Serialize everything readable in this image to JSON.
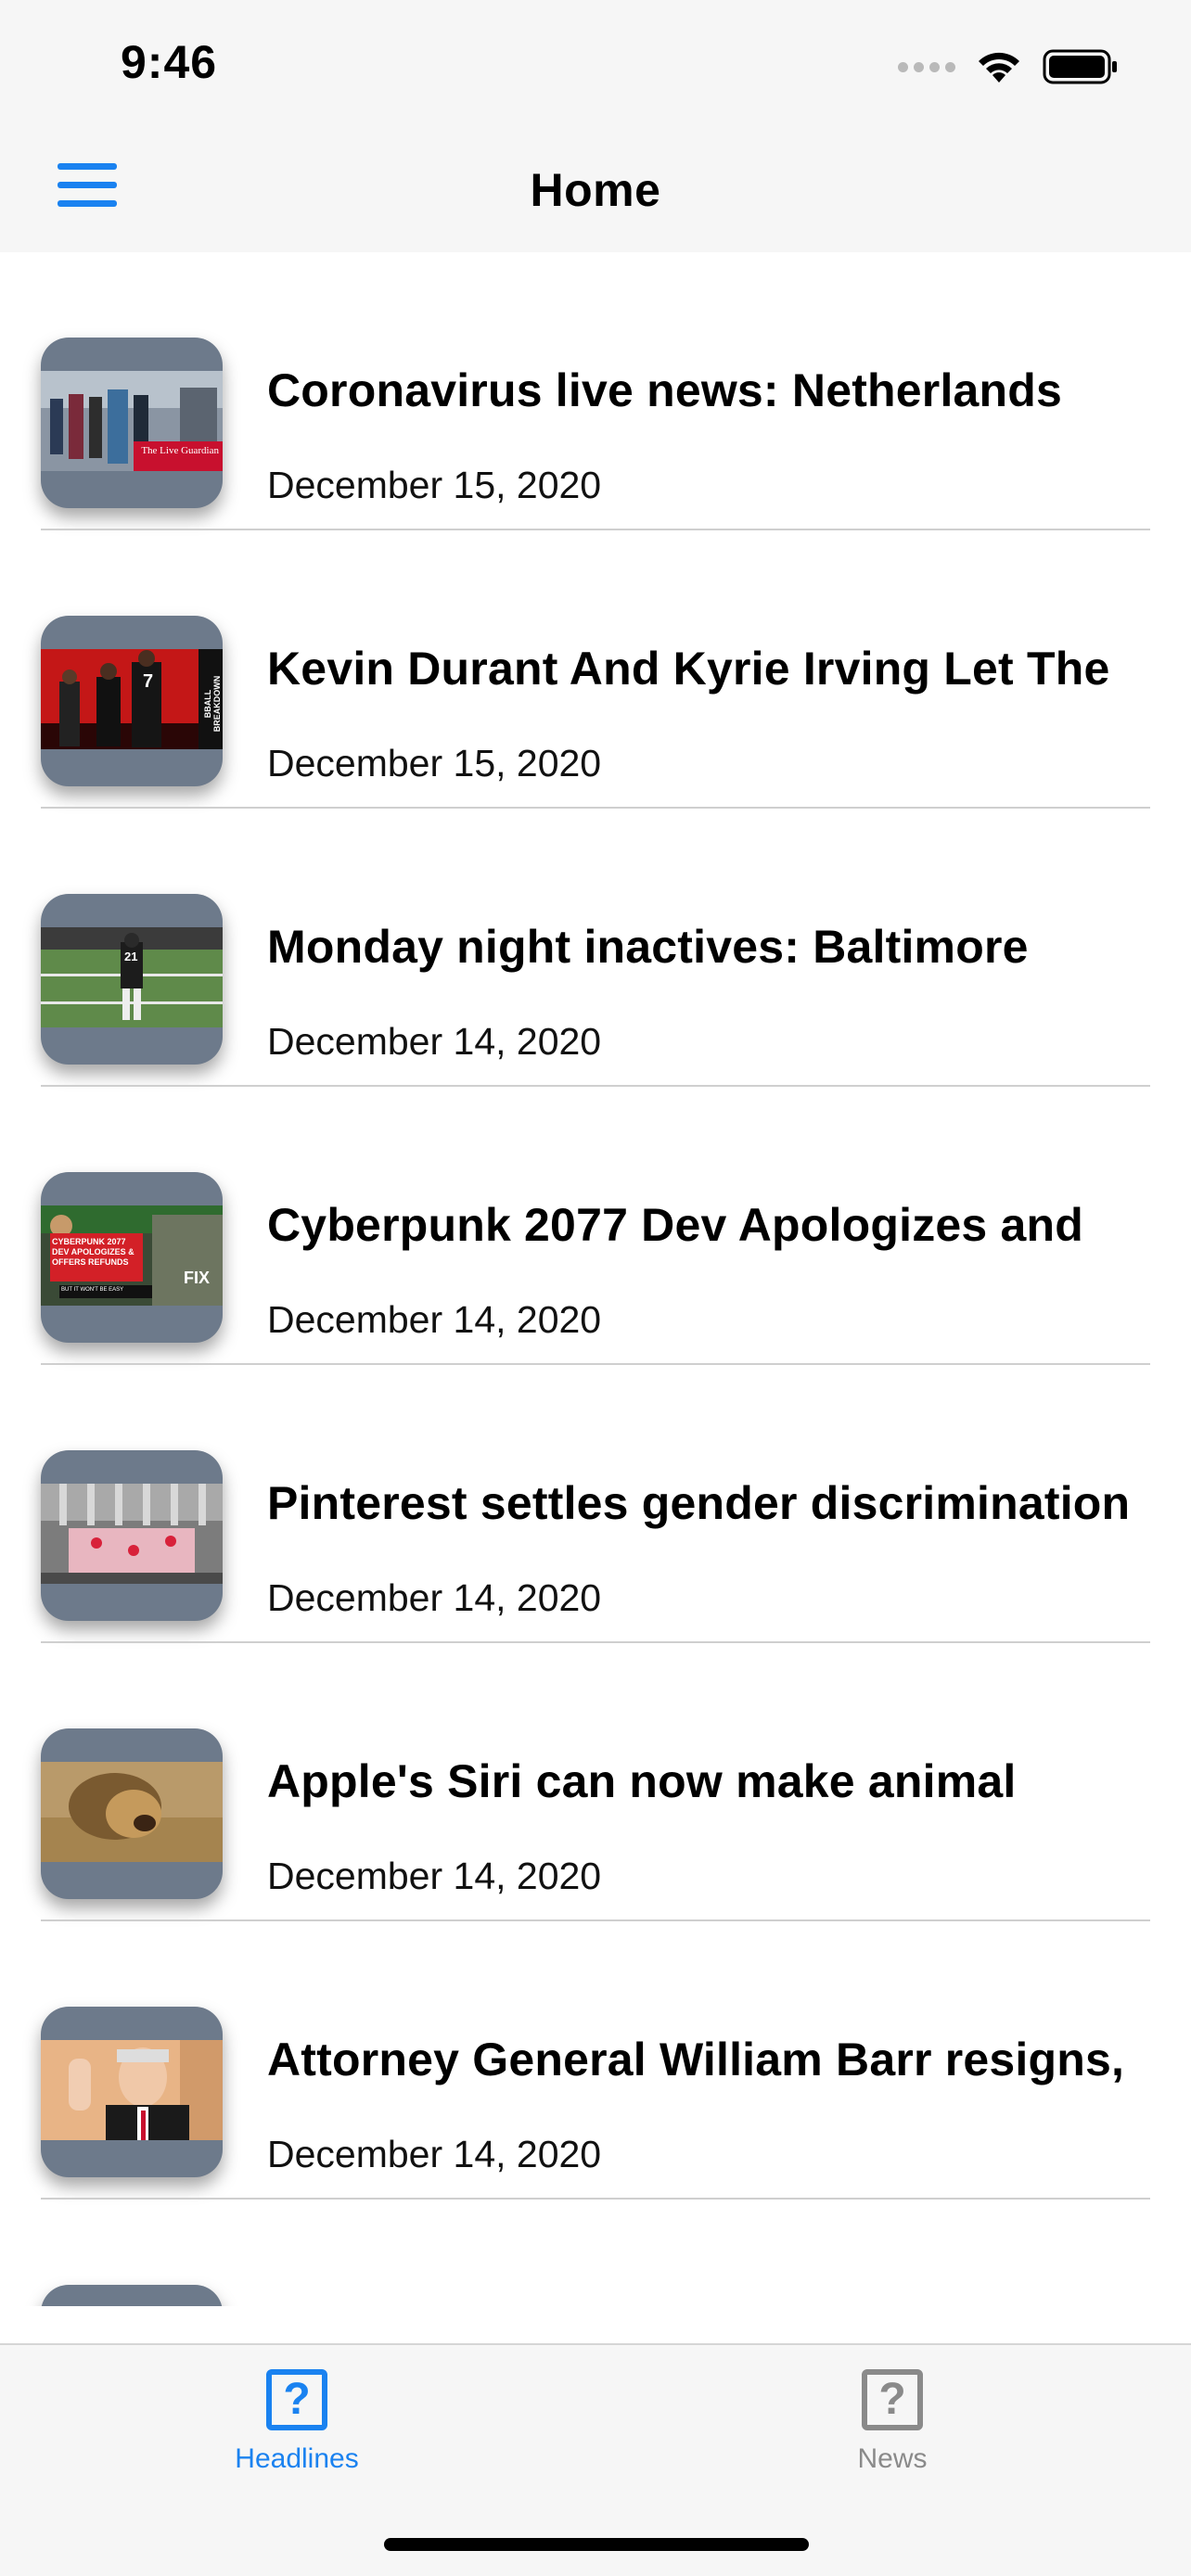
{
  "status_bar": {
    "time": "9:46"
  },
  "nav": {
    "title": "Home",
    "menu_icon": "hamburger-menu-icon"
  },
  "articles": [
    {
      "headline": "Coronavirus live news: Netherlands",
      "date": "December 15, 2020",
      "thumbnail": "crowd-street-photo"
    },
    {
      "headline": "Kevin Durant And Kyrie Irving Let The",
      "date": "December 15, 2020",
      "thumbnail": "basketball-players-photo"
    },
    {
      "headline": "Monday night inactives: Baltimore",
      "date": "December 14, 2020",
      "thumbnail": "football-player-photo"
    },
    {
      "headline": "Cyberpunk 2077 Dev Apologizes and",
      "date": "December 14, 2020",
      "thumbnail": "video-thumbnail"
    },
    {
      "headline": "Pinterest settles gender discrimination",
      "date": "December 14, 2020",
      "thumbnail": "stock-exchange-photo"
    },
    {
      "headline": "Apple's Siri can now make animal",
      "date": "December 14, 2020",
      "thumbnail": "lion-photo"
    },
    {
      "headline": "Attorney General William Barr resigns,",
      "date": "December 14, 2020",
      "thumbnail": "portrait-photo"
    }
  ],
  "thumbnail_text": {
    "guardian": "The Live Guardian",
    "cyberpunk": "CYBERPUNK 2077 DEV APOLOGIZES & OFFERS REFUNDS",
    "cyberpunk_sub": "BUT IT WON'T BE EASY",
    "fix": "FIX",
    "bball": "BBALL BREAKDOWN",
    "jersey_1": "7",
    "jersey_2": "21"
  },
  "tabs": [
    {
      "label": "Headlines",
      "icon": "question-mark-square-icon",
      "selected": true
    },
    {
      "label": "News",
      "icon": "question-mark-square-icon",
      "selected": false
    }
  ],
  "colors": {
    "accent": "#1a82f0",
    "inactive": "#8a8a8a",
    "bar_background": "#f6f6f6"
  }
}
